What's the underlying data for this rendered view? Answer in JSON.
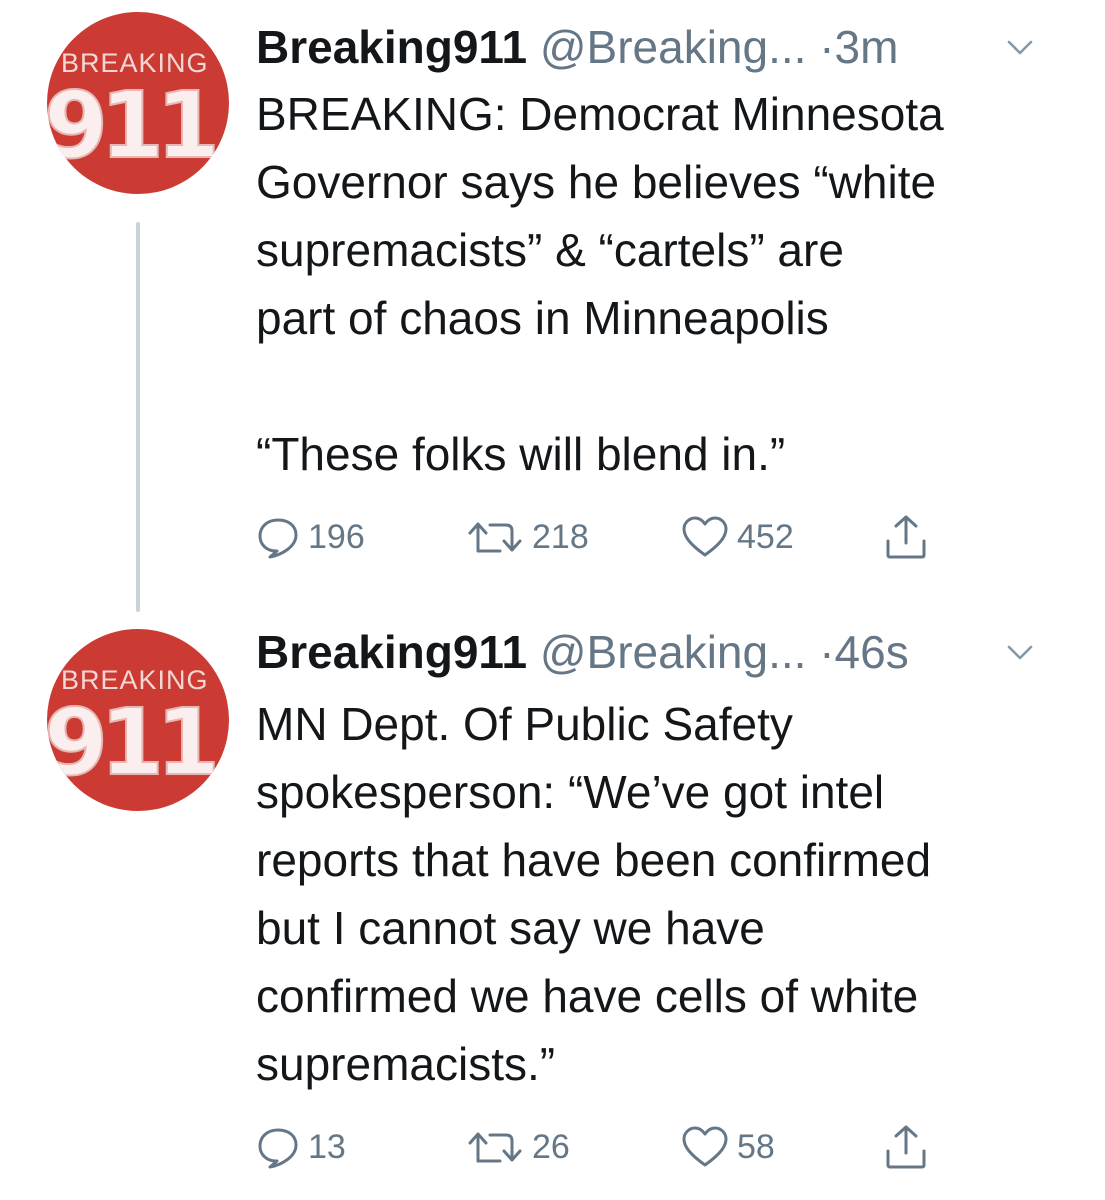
{
  "tweets": [
    {
      "avatar": {
        "top_text": "BREAKING",
        "number": "911",
        "color": "#cc3b33"
      },
      "display_name": "Breaking911",
      "handle": "@Breaking...",
      "separator": "·",
      "time": "3m",
      "text": "BREAKING: Democrat Minnesota\nGovernor says he believes “white\nsupremacists” & “cartels” are\npart of chaos in Minneapolis\n\n“These folks will blend in.”",
      "replies": "196",
      "retweets": "218",
      "likes": "452",
      "icons": {
        "reply": "reply-icon",
        "retweet": "retweet-icon",
        "like": "heart-icon",
        "share": "share-icon",
        "menu": "chevron-down-icon"
      }
    },
    {
      "avatar": {
        "top_text": "BREAKING",
        "number": "911",
        "color": "#cc3b33"
      },
      "display_name": "Breaking911",
      "handle": "@Breaking...",
      "separator": "·",
      "time": "46s",
      "text": "MN Dept. Of Public Safety\nspokesperson: “We’ve got intel\nreports that have been confirmed\nbut I cannot say we have\nconfirmed we have cells of white\nsupremacists.”",
      "replies": "13",
      "retweets": "26",
      "likes": "58",
      "icons": {
        "reply": "reply-icon",
        "retweet": "retweet-icon",
        "like": "heart-icon",
        "share": "share-icon",
        "menu": "chevron-down-icon"
      }
    }
  ],
  "colors": {
    "text": "#14171a",
    "secondary": "#657786",
    "thread_line": "#c9d3da"
  }
}
